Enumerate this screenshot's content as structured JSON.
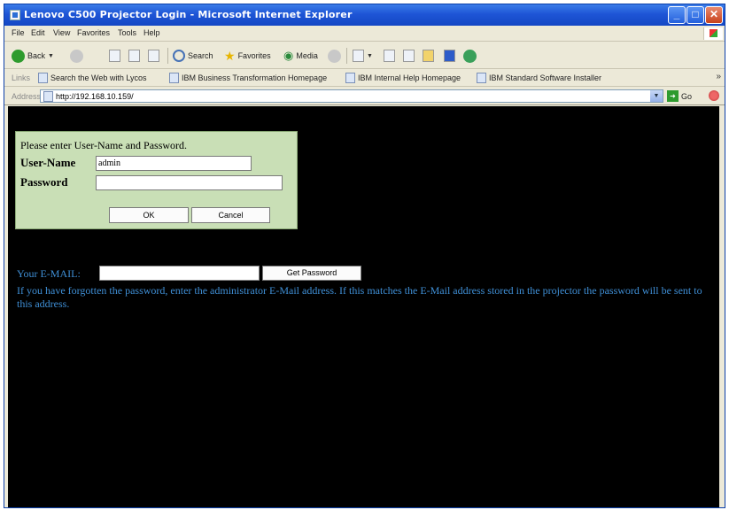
{
  "window": {
    "title": "Lenovo C500 Projector Login - Microsoft Internet Explorer"
  },
  "menu": [
    "File",
    "Edit",
    "View",
    "Favorites",
    "Tools",
    "Help"
  ],
  "toolbar": {
    "back_label": "Back",
    "search_label": "Search",
    "favorites_label": "Favorites",
    "media_label": "Media"
  },
  "links_bar": {
    "label": "Links",
    "items": [
      "Search the Web with Lycos",
      "IBM Business Transformation Homepage",
      "IBM Internal Help Homepage",
      "IBM Standard Software Installer"
    ]
  },
  "address_bar": {
    "label": "Address",
    "url": "http://192.168.10.159/",
    "go_label": "Go"
  },
  "login": {
    "prompt": "Please enter User-Name and Password.",
    "username_label": "User-Name",
    "username_value": "admin",
    "password_label": "Password",
    "password_value": "",
    "ok_label": "OK",
    "cancel_label": "Cancel"
  },
  "recovery": {
    "email_label": "Your E-MAIL:",
    "email_value": "",
    "get_password_label": "Get Password",
    "info": "If you have forgotten the password, enter the administrator E-Mail address. If this matches the E-Mail address stored in the projector the password will be sent to this address."
  },
  "colors": {
    "title_bar": "#1e55d6",
    "chrome": "#ece9d8",
    "content_bg": "#000000",
    "login_panel": "#c9dfb6",
    "info_text": "#3f8fd6"
  }
}
